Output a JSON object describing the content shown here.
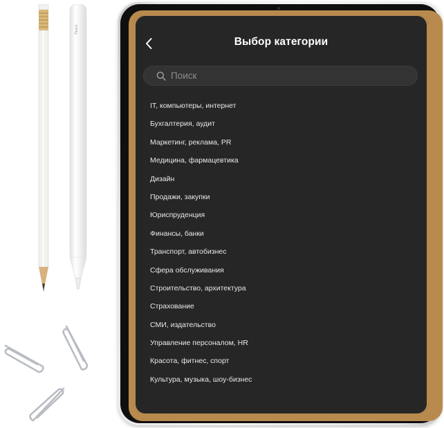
{
  "header": {
    "back_icon": "chevron-left-icon",
    "title": "Выбор категории"
  },
  "search": {
    "icon": "search-icon",
    "placeholder": "Поиск",
    "value": ""
  },
  "categories": [
    "IT, компьютеры, интернет",
    "Бухгалтерия, аудит",
    "Маркетинг, реклама, PR",
    "Медицина, фармацевтика",
    "Дизайн",
    "Продажи, закупки",
    "Юриспруденция",
    "Финансы, банки",
    "Транспорт, автобизнес",
    "Сфера обслуживания",
    "Строительство, архитектура",
    "Страхование",
    "СМИ, издательство",
    "Управление персоналом, HR",
    "Красота, фитнес, спорт",
    "Культура, музыка, шоу-бизнес"
  ],
  "props": {
    "apple_pencil_brand": "Pencil"
  },
  "colors": {
    "screen_background": "#262626",
    "search_background": "#333333",
    "text_primary": "#ffffff",
    "placeholder_text": "#8d8d8d",
    "device_trim": "#b88a4e"
  }
}
